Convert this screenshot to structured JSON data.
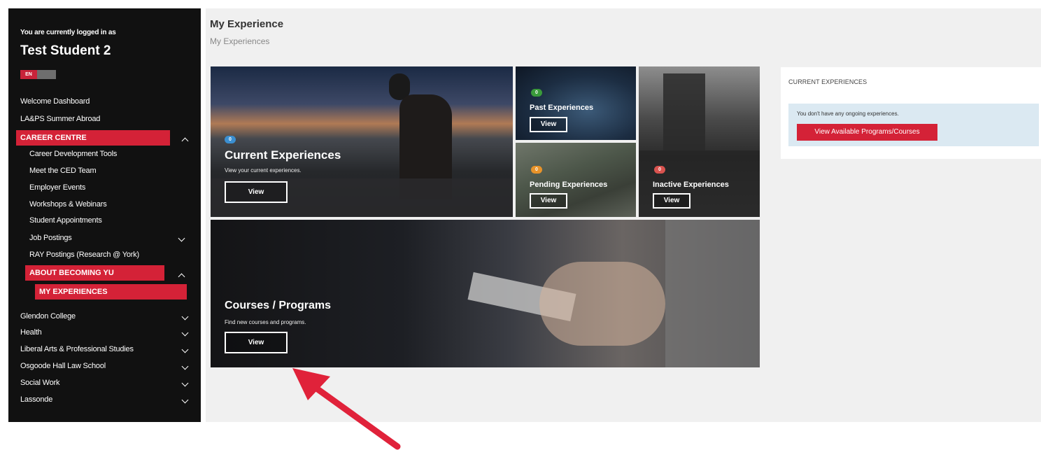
{
  "sidebar": {
    "logged_in_label": "You are currently logged in as",
    "user_name": "Test Student 2",
    "lang_on": "EN",
    "lang_off": "",
    "items": [
      {
        "label": "Welcome Dashboard"
      },
      {
        "label": "LA&PS Summer Abroad"
      },
      {
        "label": "CAREER CENTRE"
      },
      {
        "label": "Career Development Tools"
      },
      {
        "label": "Meet the CED Team"
      },
      {
        "label": "Employer Events"
      },
      {
        "label": "Workshops & Webinars"
      },
      {
        "label": "Student Appointments"
      },
      {
        "label": "Job Postings"
      },
      {
        "label": "RAY Postings (Research @ York)"
      },
      {
        "label": "ABOUT BECOMING YU"
      },
      {
        "label": "MY EXPERIENCES"
      },
      {
        "label": "Glendon College"
      },
      {
        "label": "Health"
      },
      {
        "label": "Liberal Arts & Professional Studies"
      },
      {
        "label": "Osgoode Hall Law School"
      },
      {
        "label": "Social Work"
      },
      {
        "label": "Lassonde"
      }
    ]
  },
  "main": {
    "title": "My Experience",
    "subtitle": "My Experiences",
    "tiles": {
      "current": {
        "badge": "0",
        "title": "Current Experiences",
        "desc": "View your current experiences.",
        "button": "View"
      },
      "past": {
        "badge": "0",
        "title": "Past Experiences",
        "button": "View"
      },
      "pending": {
        "badge": "0",
        "title": "Pending Experiences",
        "button": "View"
      },
      "inactive": {
        "badge": "0",
        "title": "Inactive Experiences",
        "button": "View"
      },
      "courses": {
        "title": "Courses / Programs",
        "desc": "Find new courses and programs.",
        "button": "View"
      }
    },
    "panel": {
      "heading": "CURRENT EXPERIENCES",
      "message": "You don't have any ongoing experiences.",
      "button": "View Available Programs/Courses"
    }
  },
  "colors": {
    "accent": "#d42237",
    "sidebar_bg": "#111111",
    "badge_blue": "#3b8fd1",
    "badge_green": "#3a9a3a",
    "badge_orange": "#e8932a",
    "badge_red": "#d9534f",
    "annotation_arrow": "#e0223a"
  }
}
